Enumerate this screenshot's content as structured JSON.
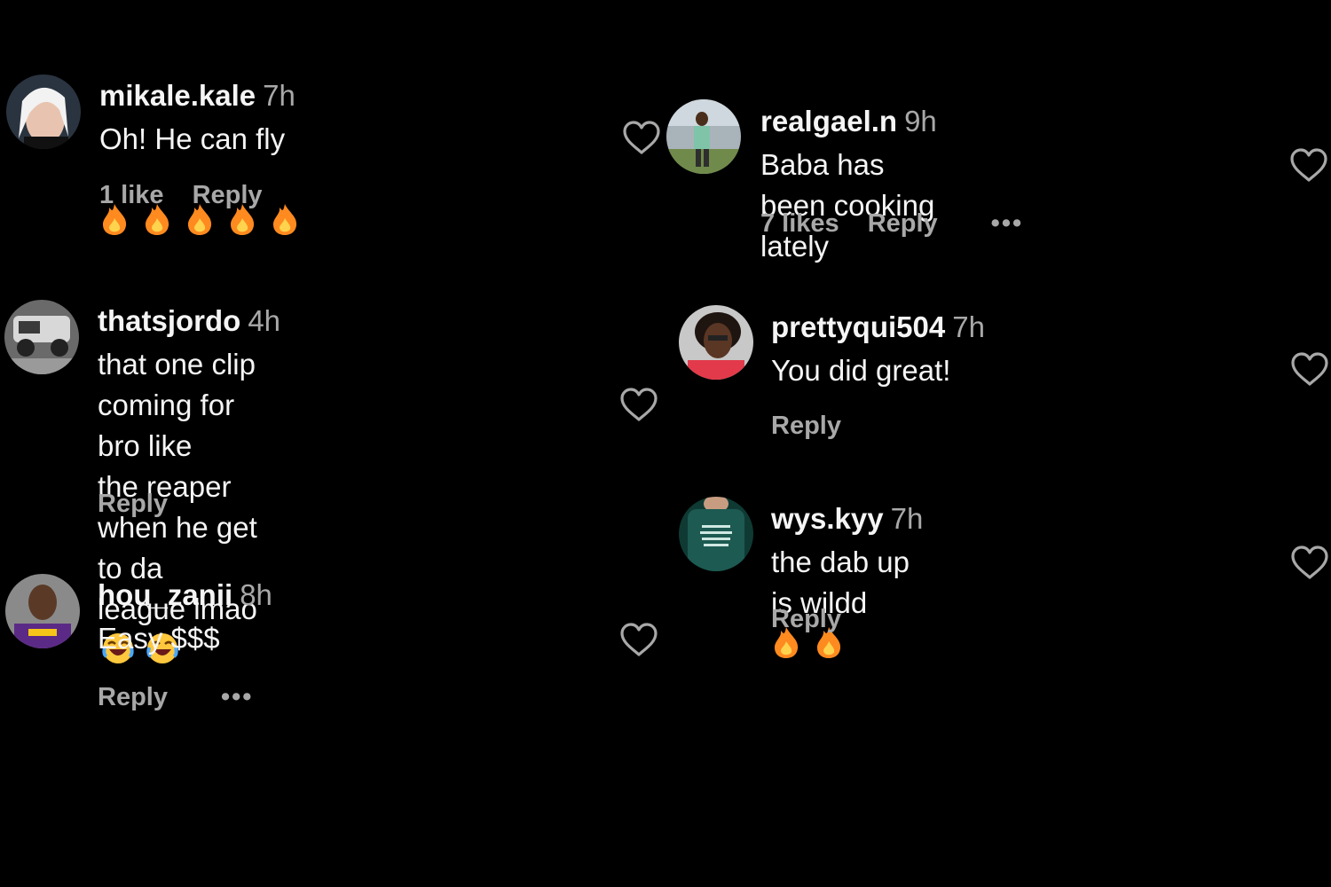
{
  "comments": [
    {
      "user": "mikale.kale",
      "time": "7h",
      "text": "Oh! He can fly",
      "emojis": "🔥🔥🔥🔥🔥",
      "likes": "1 like",
      "reply": "Reply"
    },
    {
      "user": "thatsjordo",
      "time": "4h",
      "text_lines": [
        "that one clip coming for bro like",
        "the reaper when he get to da",
        "league lmao"
      ],
      "emojis": "😂😂",
      "reply": "Reply"
    },
    {
      "user": "hou_zanii",
      "time": "8h",
      "text": "Easy $$$",
      "reply": "Reply",
      "more": "•••"
    },
    {
      "user": "realgael.n",
      "time": "9h",
      "text": "Baba has been cooking lately",
      "likes": "7 likes",
      "reply": "Reply",
      "more": "•••"
    },
    {
      "user": "prettyqui504",
      "time": "7h",
      "text": "You did great!",
      "reply": "Reply"
    },
    {
      "user": "wys.kyy",
      "time": "7h",
      "text": "the dab up is wildd",
      "emojis": "🔥🔥",
      "reply": "Reply"
    }
  ],
  "colors": {
    "background": "#000000",
    "primary_text": "#f5f5f5",
    "secondary_text": "#a8a8a8",
    "fire": "#ff8a1f"
  },
  "icons": [
    "heart-outline-icon",
    "more-options-icon",
    "fire-emoji",
    "laughing-emoji"
  ]
}
